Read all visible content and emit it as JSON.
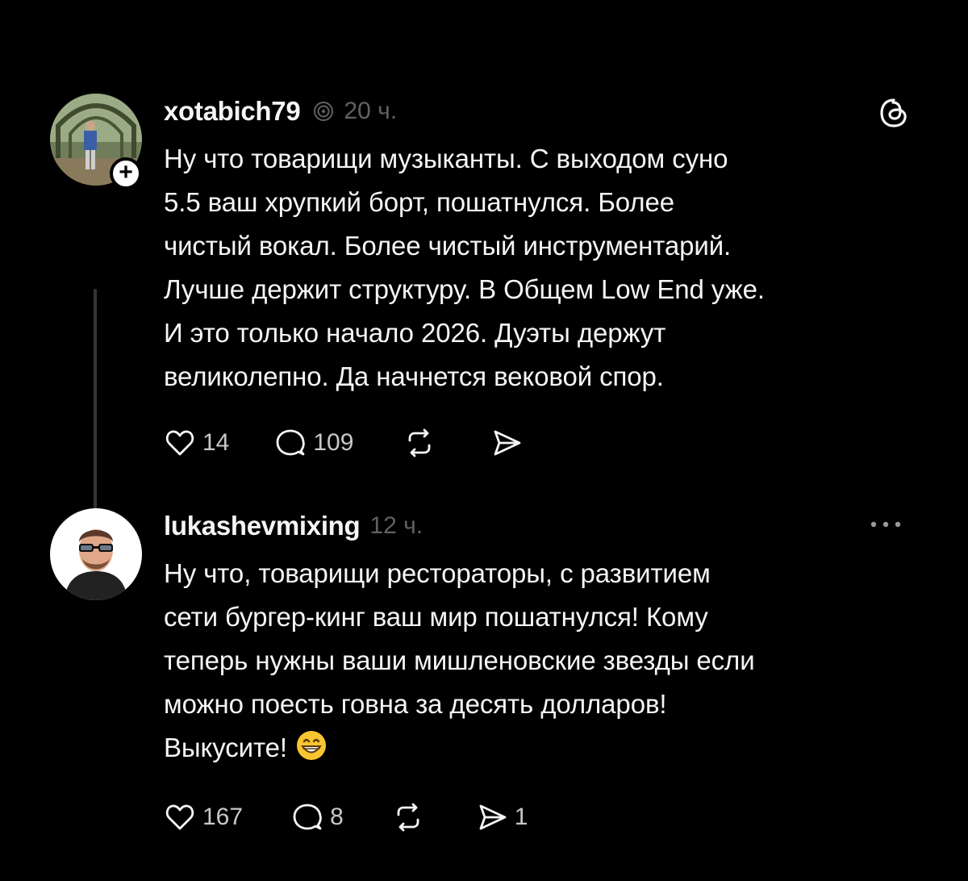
{
  "posts": [
    {
      "username": "xotabich79",
      "timestamp": "20 ч.",
      "avatar_icon": "avatar-photo-park",
      "has_follow_badge": true,
      "follow_symbol": "+",
      "corner_icon": "threads-logo-icon",
      "text": "Ну что товарищи музыканты. С выходом суно\n5.5 ваш хрупкий борт, пошатнулся. Более\nчистый вокал. Более чистый инструментарий.\nЛучше держит структуру. В Общем Low End уже.\nИ это только начало 2026. Дуэты держут\nвеликолепно. Да начнется вековой спор.",
      "likes": "14",
      "replies": "109",
      "reposts": "",
      "shares": ""
    },
    {
      "username": "lukashevmixing",
      "timestamp": "12 ч.",
      "avatar_icon": "avatar-photo-man-glasses",
      "corner_icon": "more-options-icon",
      "text": "Ну что, товарищи рестораторы, с развитием\nсети бургер-кинг ваш мир пошатнулся! Кому\nтеперь нужны ваши мишленовские звезды если\nможно поесть говна за десять долларов!\nВыкусите!",
      "emoji": "grinning-face-emoji",
      "likes": "167",
      "replies": "8",
      "reposts": "",
      "shares": "1"
    }
  ],
  "colors": {
    "background": "#000000",
    "text": "#f3f5f7",
    "secondary": "#616161",
    "thread_line": "#333638"
  }
}
